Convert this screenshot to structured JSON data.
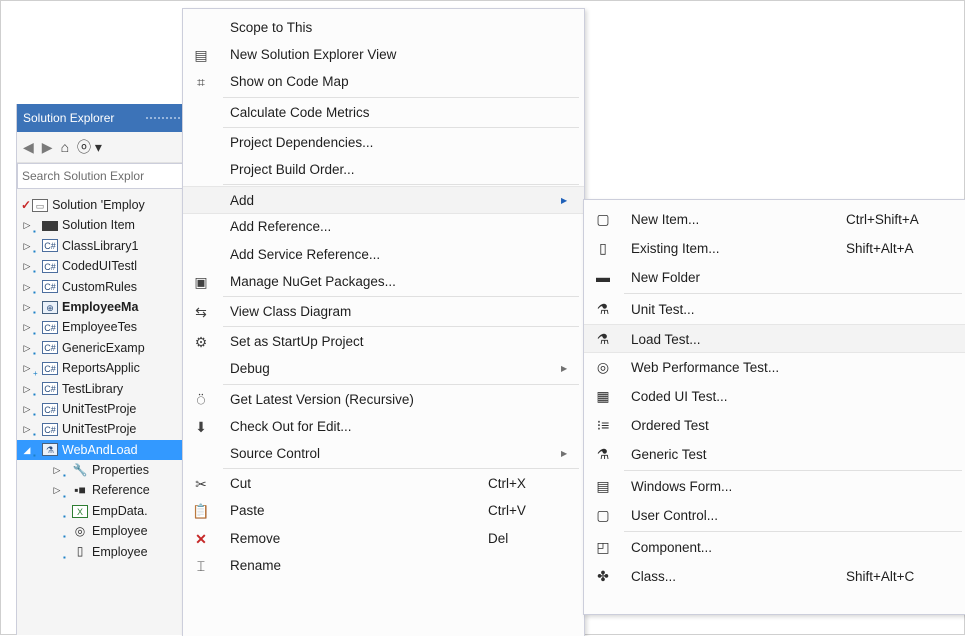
{
  "solution_explorer": {
    "title": "Solution Explorer",
    "toolbar": {
      "back": "◀",
      "forward": "▶",
      "home": "⌂",
      "history": "ⓞ ▾"
    },
    "search_placeholder": "Search Solution Explor",
    "tree": [
      {
        "label": "Solution 'Employ",
        "icon": "solution-icon",
        "prefix": "✓"
      },
      {
        "label": "Solution Item",
        "icon": "folder-icon",
        "arrow": "▷"
      },
      {
        "label": "ClassLibrary1",
        "icon": "csharp-project-icon",
        "arrow": "▷"
      },
      {
        "label": "CodedUITestl",
        "icon": "csharp-project-icon",
        "arrow": "▷"
      },
      {
        "label": "CustomRules",
        "icon": "csharp-project-icon",
        "arrow": "▷"
      },
      {
        "label": "EmployeeMa",
        "icon": "web-project-icon",
        "arrow": "▷",
        "bold": true
      },
      {
        "label": "EmployeeTes",
        "icon": "csharp-project-icon",
        "arrow": "▷"
      },
      {
        "label": "GenericExamp",
        "icon": "csharp-project-icon",
        "arrow": "▷"
      },
      {
        "label": "ReportsApplic",
        "icon": "csharp-project-icon",
        "arrow": "▷",
        "plus": true
      },
      {
        "label": "TestLibrary",
        "icon": "csharp-project-icon",
        "arrow": "▷"
      },
      {
        "label": "UnitTestProje",
        "icon": "csharp-project-icon",
        "arrow": "▷"
      },
      {
        "label": "UnitTestProje",
        "icon": "csharp-project-icon",
        "arrow": "▷"
      },
      {
        "label": "WebAndLoad",
        "icon": "test-project-icon",
        "arrow": "◢",
        "selected": true
      },
      {
        "label": "Properties",
        "icon": "wrench-icon",
        "arrow": "▷",
        "indent": 1
      },
      {
        "label": "Reference",
        "icon": "references-icon",
        "arrow": "▷",
        "indent": 1
      },
      {
        "label": "EmpData.",
        "icon": "xml-file-icon",
        "indent": 1
      },
      {
        "label": "Employee",
        "icon": "webtest-file-icon",
        "indent": 1
      },
      {
        "label": "Employee",
        "icon": "file-icon",
        "indent": 1
      }
    ]
  },
  "context_menu": {
    "items": [
      {
        "label": "Scope to This"
      },
      {
        "label": "New Solution Explorer View",
        "icon": "new-view-icon"
      },
      {
        "label": "Show on Code Map",
        "icon": "code-map-icon"
      },
      {
        "sep": true
      },
      {
        "label": "Calculate Code Metrics"
      },
      {
        "sep": true
      },
      {
        "label": "Project Dependencies..."
      },
      {
        "label": "Project Build Order..."
      },
      {
        "sep": true
      },
      {
        "label": "Add",
        "submenu": true,
        "highlighted": true
      },
      {
        "label": "Add Reference..."
      },
      {
        "label": "Add Service Reference..."
      },
      {
        "label": "Manage NuGet Packages...",
        "icon": "nuget-icon"
      },
      {
        "sep": true
      },
      {
        "label": "View Class Diagram",
        "icon": "class-diagram-icon"
      },
      {
        "sep": true
      },
      {
        "label": "Set as StartUp Project",
        "icon": "gear-icon"
      },
      {
        "label": "Debug",
        "submenu": true
      },
      {
        "sep": true
      },
      {
        "label": "Get Latest Version (Recursive)",
        "icon": "get-latest-icon"
      },
      {
        "label": "Check Out for Edit...",
        "icon": "check-out-icon"
      },
      {
        "label": "Source Control",
        "submenu": true
      },
      {
        "sep": true
      },
      {
        "label": "Cut",
        "shortcut": "Ctrl+X",
        "icon": "cut-icon"
      },
      {
        "label": "Paste",
        "shortcut": "Ctrl+V",
        "icon": "paste-icon"
      },
      {
        "label": "Remove",
        "shortcut": "Del",
        "icon": "remove-icon"
      },
      {
        "label": "Rename",
        "icon": "rename-icon"
      }
    ]
  },
  "add_submenu": {
    "items": [
      {
        "label": "New Item...",
        "shortcut": "Ctrl+Shift+A",
        "icon": "new-item-icon"
      },
      {
        "label": "Existing Item...",
        "shortcut": "Shift+Alt+A",
        "icon": "existing-item-icon"
      },
      {
        "label": "New Folder",
        "icon": "new-folder-icon"
      },
      {
        "sep": true
      },
      {
        "label": "Unit Test...",
        "icon": "unit-test-icon"
      },
      {
        "label": "Load Test...",
        "icon": "load-test-icon",
        "highlighted": true
      },
      {
        "label": "Web Performance Test...",
        "icon": "web-performance-test-icon"
      },
      {
        "label": "Coded UI Test...",
        "icon": "coded-ui-test-icon"
      },
      {
        "label": "Ordered Test",
        "icon": "ordered-test-icon"
      },
      {
        "label": "Generic Test",
        "icon": "generic-test-icon"
      },
      {
        "sep": true
      },
      {
        "label": "Windows Form...",
        "icon": "windows-form-icon"
      },
      {
        "label": "User Control...",
        "icon": "user-control-icon"
      },
      {
        "sep": true
      },
      {
        "label": "Component...",
        "icon": "component-icon"
      },
      {
        "label": "Class...",
        "shortcut": "Shift+Alt+C",
        "icon": "class-icon"
      }
    ]
  },
  "colors": {
    "title_bar": "#3c73b8",
    "selection": "#3399ff",
    "remove_icon": "#c62828"
  }
}
